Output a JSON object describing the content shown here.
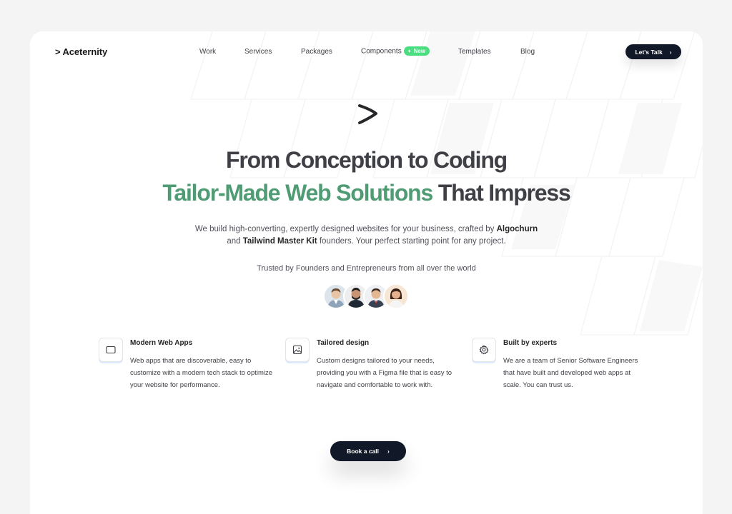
{
  "brand": {
    "logo_text": "Aceternity"
  },
  "nav": {
    "links": [
      {
        "label": "Work"
      },
      {
        "label": "Services"
      },
      {
        "label": "Packages"
      },
      {
        "label": "Components",
        "badge": "New"
      },
      {
        "label": "Templates"
      },
      {
        "label": "Blog"
      }
    ],
    "cta_label": "Let's Talk"
  },
  "hero": {
    "line1": "From Conception to Coding",
    "line2_highlight": "Tailor-Made Web Solutions",
    "line2_rest": " That Impress",
    "subtitle_part1": "We build high-converting, expertly designed websites for your business, crafted by ",
    "subtitle_bold1": "Algochurn",
    "subtitle_part2": "and ",
    "subtitle_bold2": "Tailwind Master Kit",
    "subtitle_part3": " founders. Your perfect starting point for any project.",
    "trusted_text": "Trusted by Founders and Entrepreneurs from all over the world"
  },
  "features": [
    {
      "icon": "browser-window-icon",
      "title": "Modern Web Apps",
      "description": "Web apps that are discoverable, easy to customize with a modern tech stack to optimize your website for performance."
    },
    {
      "icon": "image-icon",
      "title": "Tailored design",
      "description": "Custom designs tailored to your needs, providing you with a Figma file that is easy to navigate and comfortable to work with."
    },
    {
      "icon": "gear-icon",
      "title": "Built by experts",
      "description": "We are a team of Senior Software Engineers that have built and developed web apps at scale. You can trust us."
    }
  ],
  "cta": {
    "label": "Book a call"
  },
  "colors": {
    "accent_green": "#4f9b74",
    "badge_green": "#4ade80",
    "button_dark": "#111827",
    "page_bg": "#f4f4f5"
  }
}
